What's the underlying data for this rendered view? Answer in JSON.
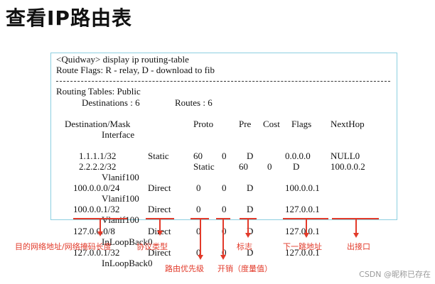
{
  "title": "查看IP路由表",
  "terminal": {
    "command_line": "<Quidway> display ip routing-table",
    "flags_line": "Route Flags: R - relay, D - download to fib",
    "routing_tables": "Routing Tables: Public",
    "destinations_label": "Destinations : 6",
    "routes_label": "Routes : 6",
    "headers": {
      "destination_mask": "Destination/Mask",
      "proto": "Proto",
      "pre": "Pre",
      "cost": "Cost",
      "flags": "Flags",
      "nexthop": "NextHop",
      "interface": "Interface"
    },
    "routes": [
      {
        "destination": "1.1.1.1/32",
        "proto": "Static",
        "pre": "60",
        "cost": "0",
        "flags": "D",
        "nexthop": "0.0.0.0",
        "out_interface": "NULL0",
        "interface": ""
      },
      {
        "destination": "2.2.2.2/32",
        "proto": "Static",
        "pre": "60",
        "cost": "0",
        "flags": "D",
        "nexthop": "100.0.0.2",
        "out_interface": "",
        "interface": "Vlanif100"
      },
      {
        "destination": "100.0.0.0/24",
        "proto": "Direct",
        "pre": "0",
        "cost": "0",
        "flags": "D",
        "nexthop": "100.0.0.1",
        "out_interface": "",
        "interface": "Vlanif100"
      },
      {
        "destination": "100.0.0.1/32",
        "proto": "Direct",
        "pre": "0",
        "cost": "0",
        "flags": "D",
        "nexthop": "127.0.0.1",
        "out_interface": "",
        "interface": "Vlanif100"
      },
      {
        "destination": "127.0.0.0/8",
        "proto": "Direct",
        "pre": "0",
        "cost": "0",
        "flags": "D",
        "nexthop": "127.0.0.1",
        "out_interface": "",
        "interface": "InLoopBack0"
      },
      {
        "destination": "127.0.0.1/32",
        "proto": "Direct",
        "pre": "0",
        "cost": "0",
        "flags": "D",
        "nexthop": "127.0.0.1",
        "out_interface": "",
        "interface": "InLoopBack0"
      }
    ]
  },
  "annotations": {
    "destination_mask": "目的网络地址/网络掩码长度",
    "proto": "协议类型",
    "pre": "路由优先级",
    "cost": "开销（度量值）",
    "flags": "标志",
    "nexthop": "下一跳地址",
    "interface": "出接口"
  },
  "watermark": "CSDN @昵称已存在",
  "colors": {
    "annotation": "#e23a2a",
    "terminal_border": "#8ccfe0"
  }
}
